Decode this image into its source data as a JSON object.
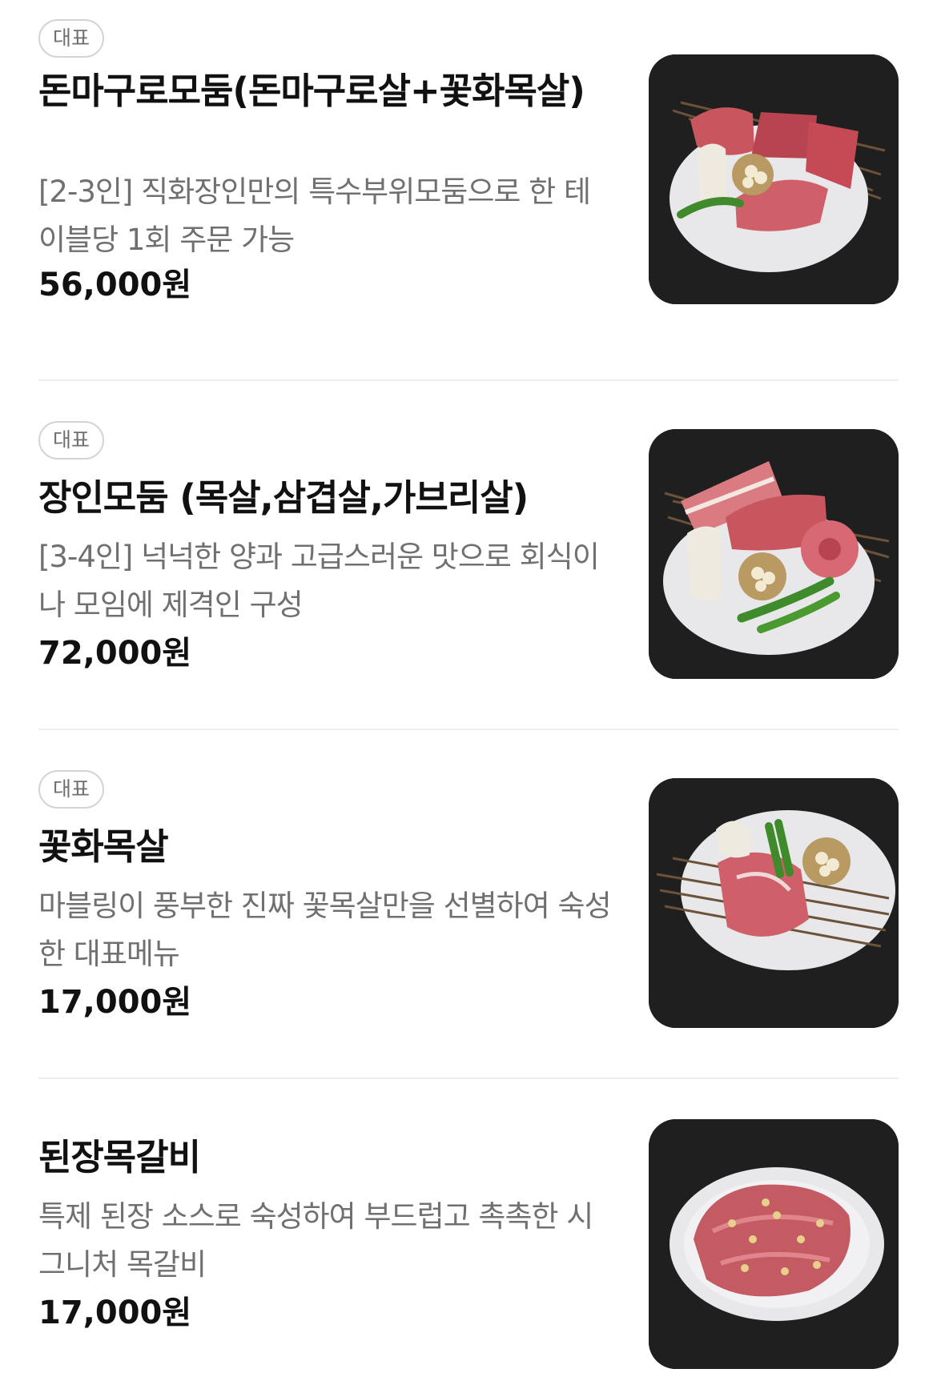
{
  "menu": {
    "items": [
      {
        "badge": "대표",
        "name": "돈마구로모둠(돈마구로살+꽃화목살)",
        "description": "[2-3인] 직화장인만의 특수부위모둠으로 한 테이블당 1회 주문 가능",
        "price": "56,000원",
        "image_icon": "meat-platter-photo"
      },
      {
        "badge": "대표",
        "name": "장인모둠 (목살,삼겹살,가브리살)",
        "description": "[3-4인] 넉넉한 양과 고급스러운 맛으로 회식이나 모임에 제격인 구성",
        "price": "72,000원",
        "image_icon": "meat-platter-photo"
      },
      {
        "badge": "대표",
        "name": "꽃화목살",
        "description": "마블링이 풍부한 진짜 꽃목살만을 선별하여 숙성한 대표메뉴",
        "price": "17,000원",
        "image_icon": "pork-neck-photo"
      },
      {
        "name": "된장목갈비",
        "description": "특제 된장 소스로 숙성하여 부드럽고 촉촉한 시그니처 목갈비",
        "price": "17,000원",
        "image_icon": "marinated-rib-photo"
      }
    ]
  },
  "colors": {
    "background": "#ffffff",
    "title": "#111111",
    "description": "#707070",
    "badge_border": "#d4d4d4",
    "divider": "#eeeeee",
    "photo_background": "#1f1f1f",
    "meat": "#c9565e",
    "plate": "#e8e8ea"
  }
}
